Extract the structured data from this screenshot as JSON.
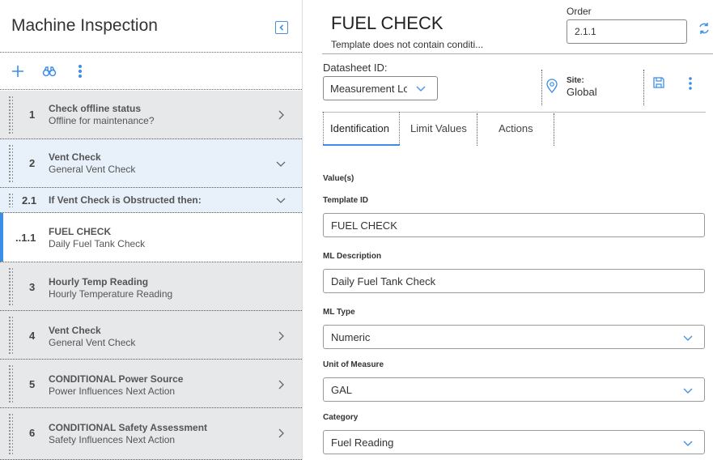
{
  "left_panel": {
    "title": "Machine Inspection",
    "toolbar": {
      "add_icon": "plus-icon",
      "search_icon": "binoculars-icon",
      "more_icon": "vertical-dots-icon"
    },
    "rows": [
      {
        "num": "1",
        "title": "Check offline status",
        "subtitle": "Offline for maintenance?",
        "chevron": "right"
      },
      {
        "num": "2",
        "title": "Vent Check",
        "subtitle": "General Vent Check",
        "chevron": "down"
      },
      {
        "num": "2.1",
        "title": "If Vent Check is Obstructed then:",
        "subtitle": "",
        "chevron": "down"
      },
      {
        "num": "..1.1",
        "title": "FUEL CHECK",
        "subtitle": "Daily Fuel Tank Check",
        "chevron": ""
      },
      {
        "num": "3",
        "title": "Hourly Temp Reading",
        "subtitle": "Hourly Temperature Reading",
        "chevron": ""
      },
      {
        "num": "4",
        "title": "Vent Check",
        "subtitle": "General Vent Check",
        "chevron": "right"
      },
      {
        "num": "5",
        "title": "CONDITIONAL Power Source",
        "subtitle": "Power Influences Next Action",
        "chevron": "right"
      },
      {
        "num": "6",
        "title": "CONDITIONAL Safety Assessment",
        "subtitle": "Safety Influences Next Action",
        "chevron": "right"
      }
    ]
  },
  "right_panel": {
    "title": "FUEL CHECK",
    "subtitle": "Template does not contain conditi...",
    "order_label": "Order",
    "order_value": "2.1.1",
    "datasheet_label": "Datasheet ID:",
    "datasheet_value": "Measurement Lo",
    "site_label": "Site:",
    "site_value": "Global",
    "tabs": [
      "Identification",
      "Limit Values",
      "Actions"
    ],
    "section_label": "Value(s)",
    "fields": [
      {
        "label": "Template ID",
        "value": "FUEL CHECK",
        "dropdown": false
      },
      {
        "label": "ML Description",
        "value": "Daily Fuel Tank Check",
        "dropdown": false
      },
      {
        "label": "ML Type",
        "value": "Numeric",
        "dropdown": true
      },
      {
        "label": "Unit of Measure",
        "value": "GAL",
        "dropdown": true
      },
      {
        "label": "Category",
        "value": "Fuel Reading",
        "dropdown": true
      }
    ]
  },
  "colors": {
    "accent": "#3a8ee6",
    "row_bg": "#e6e8ea",
    "row_bg_light": "#e8f1fa"
  }
}
